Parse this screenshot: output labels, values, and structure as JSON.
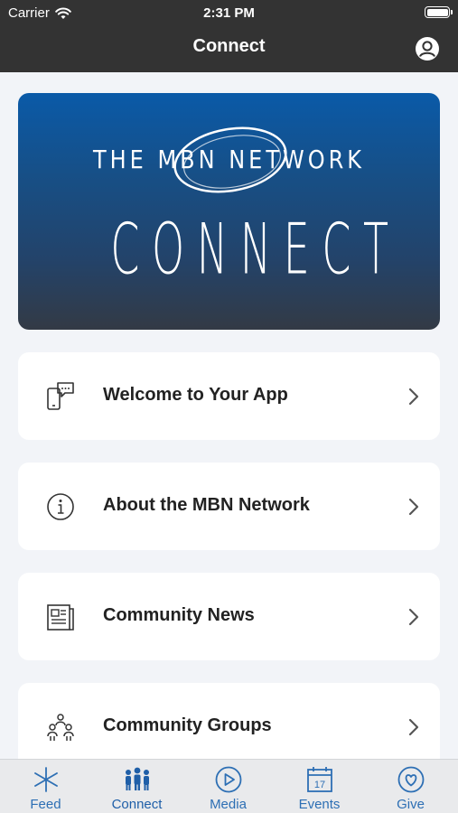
{
  "status_bar": {
    "carrier": "Carrier",
    "time": "2:31 PM"
  },
  "header": {
    "title": "Connect"
  },
  "banner": {
    "brand": "THE MBN NETWORK",
    "headline": "CONNECT"
  },
  "menu": {
    "items": [
      {
        "label": "Welcome to Your App",
        "icon": "chat-phone-icon"
      },
      {
        "label": "About the MBN Network",
        "icon": "info-icon"
      },
      {
        "label": "Community News",
        "icon": "newspaper-icon"
      },
      {
        "label": "Community Groups",
        "icon": "people-group-icon"
      }
    ]
  },
  "tabbar": {
    "tabs": [
      {
        "label": "Feed",
        "icon": "feed-icon",
        "selected": false
      },
      {
        "label": "Connect",
        "icon": "connect-icon",
        "selected": true
      },
      {
        "label": "Media",
        "icon": "play-icon",
        "selected": false
      },
      {
        "label": "Events",
        "icon": "calendar-icon",
        "selected": false,
        "badge_number": "17"
      },
      {
        "label": "Give",
        "icon": "heart-icon",
        "selected": false
      }
    ]
  },
  "colors": {
    "header_bg": "#333333",
    "accent": "#2d6fb4",
    "tab_selected": "#1f5fa8",
    "page_bg": "#f2f4f8"
  }
}
